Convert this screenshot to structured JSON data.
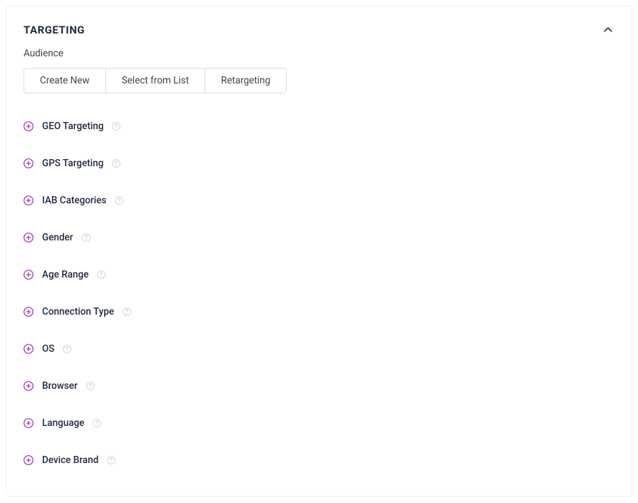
{
  "panel": {
    "title": "TARGETING",
    "audience_label": "Audience",
    "tabs": [
      {
        "label": "Create New"
      },
      {
        "label": "Select from List"
      },
      {
        "label": "Retargeting"
      }
    ],
    "options": [
      {
        "label": "GEO Targeting"
      },
      {
        "label": "GPS Targeting"
      },
      {
        "label": "IAB Categories"
      },
      {
        "label": "Gender"
      },
      {
        "label": "Age Range"
      },
      {
        "label": "Connection Type"
      },
      {
        "label": "OS"
      },
      {
        "label": "Browser"
      },
      {
        "label": "Language"
      },
      {
        "label": "Device Brand"
      }
    ]
  },
  "colors": {
    "accent": "#a52bb5",
    "help": "#d1d4db"
  }
}
